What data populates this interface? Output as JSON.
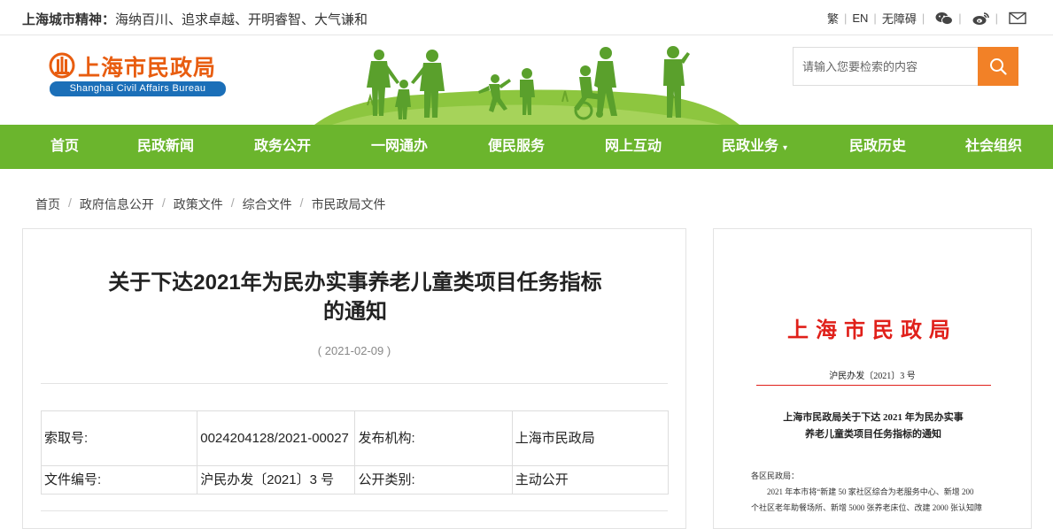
{
  "topbar": {
    "motto_lead": "上海城市精神：",
    "motto_text": "海纳百川、追求卓越、开明睿智、大气谦和",
    "links": {
      "traditional": "繁",
      "english": "EN",
      "accessibility": "无障碍"
    }
  },
  "header": {
    "logo_cn": "上海市民政局",
    "logo_en": "Shanghai Civil Affairs Bureau"
  },
  "search": {
    "placeholder": "请输入您要检索的内容"
  },
  "nav": {
    "items": [
      "首页",
      "民政新闻",
      "政务公开",
      "一网通办",
      "便民服务",
      "网上互动",
      "民政业务",
      "民政历史",
      "社会组织"
    ],
    "dropdown_caret": "▾"
  },
  "breadcrumb": [
    "首页",
    "政府信息公开",
    "政策文件",
    "综合文件",
    "市民政局文件"
  ],
  "article": {
    "title_line1": "关于下达2021年为民办实事养老儿童类项目任务指标",
    "title_line2": "的通知",
    "date": "( 2021-02-09 )",
    "meta": {
      "index_label": "索取号:",
      "index_value": "0024204128/2021-00027",
      "publisher_label": "发布机构:",
      "publisher_value": "上海市民政局",
      "docno_label": "文件编号:",
      "docno_value": "沪民办发〔2021〕3 号",
      "category_label": "公开类别:",
      "category_value": "主动公开"
    }
  },
  "preview": {
    "org": "上海市民政局",
    "doc_number": "沪民办发〔2021〕3 号",
    "title_line1": "上海市民政局关于下达 2021 年为民办实事",
    "title_line2": "养老儿童类项目任务指标的通知",
    "salutation": "各区民政局：",
    "body_line1": "2021 年本市将“新建 50 家社区综合为老服务中心、新增 200",
    "body_line2": "个社区老年助餐场所、新增 5000 张养老床位、改建 2000 张认知障"
  },
  "colors": {
    "nav_green": "#6bb52d",
    "search_orange": "#f28127",
    "logo_orange": "#e85d10",
    "logo_blue": "#1b6fb8",
    "doc_red": "#e0201a"
  }
}
